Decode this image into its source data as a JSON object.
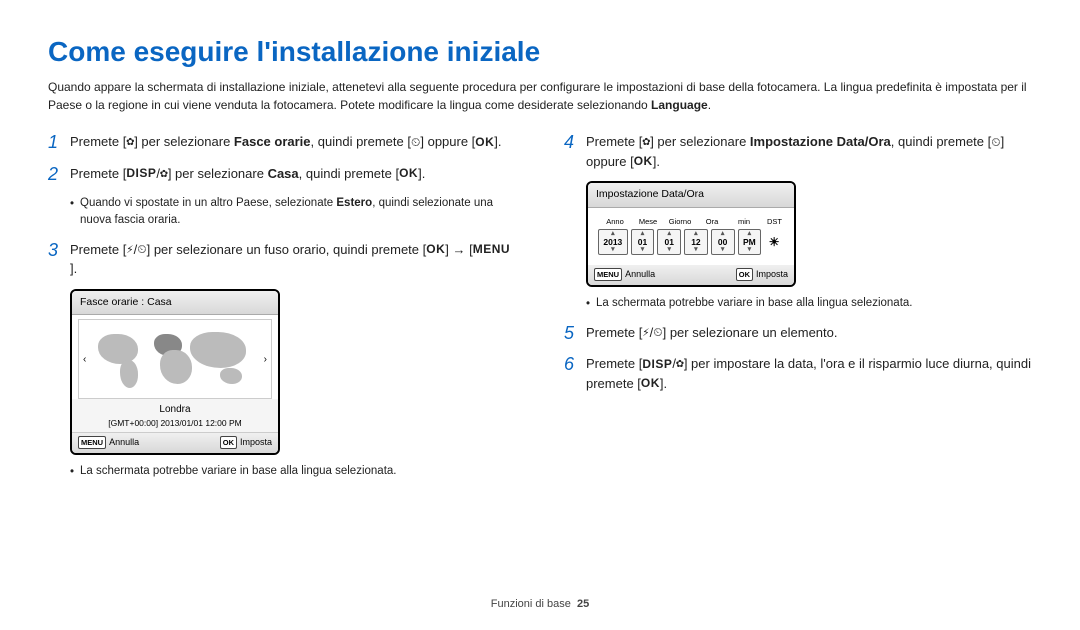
{
  "title": "Come eseguire l'installazione iniziale",
  "intro_part1": "Quando appare la schermata di installazione iniziale, attenetevi alla seguente procedura per configurare le impostazioni di base della fotocamera. La lingua predefinita è impostata per il Paese o la regione in cui viene venduta la fotocamera. Potete modificare la lingua come desiderate selezionando ",
  "intro_lang": "Language",
  "intro_part2": ".",
  "steps_left": {
    "s1": {
      "num": "1",
      "a": "Premete [",
      "b": "] per selezionare ",
      "c": "Fasce orarie",
      "d": ", quindi premete [",
      "e": "] oppure [",
      "f": "]."
    },
    "s2": {
      "num": "2",
      "a": "Premete [",
      "b": "/",
      "c": "] per selezionare ",
      "d": "Casa",
      "e": ", quindi premete [",
      "f": "]."
    },
    "s2b": {
      "a": "Quando vi spostate in un altro Paese, selezionate ",
      "b": "Estero",
      "c": ", quindi selezionate una nuova fascia oraria."
    },
    "s3": {
      "num": "3",
      "a": "Premete [",
      "b": "/",
      "c": "] per selezionare un fuso orario, quindi premete [",
      "d": "] → [",
      "e": "]."
    },
    "s3b": "La schermata potrebbe variare in base alla lingua selezionata."
  },
  "steps_right": {
    "s4": {
      "num": "4",
      "a": "Premete [",
      "b": "] per selezionare ",
      "c": "Impostazione Data/Ora",
      "d": ", quindi premete [",
      "e": "] oppure [",
      "f": "]."
    },
    "s4b": "La schermata potrebbe variare in base alla lingua selezionata.",
    "s5": {
      "num": "5",
      "a": "Premete [",
      "b": "/",
      "c": "] per selezionare un elemento."
    },
    "s6": {
      "num": "6",
      "a": "Premete [",
      "b": "/",
      "c": "] per impostare la data, l'ora e il risparmio luce diurna, quindi premete [",
      "d": "]."
    }
  },
  "lcd_tz": {
    "title": "Fasce orarie : Casa",
    "city": "Londra",
    "datetime": "[GMT+00:00] 2013/01/01 12:00 PM",
    "menu_label": "MENU",
    "cancel": "Annulla",
    "ok_label": "OK",
    "set": "Imposta",
    "left_arrow": "‹",
    "right_arrow": "›"
  },
  "lcd_dt": {
    "title": "Impostazione Data/Ora",
    "labels": {
      "y": "Anno",
      "m": "Mese",
      "d": "Giorno",
      "h": "Ora",
      "min": "min",
      "dst": "DST"
    },
    "values": {
      "y": "2013",
      "m": "01",
      "d": "01",
      "h": "12",
      "min": "00",
      "ampm": "PM"
    },
    "menu_label": "MENU",
    "cancel": "Annulla",
    "ok_label": "OK",
    "set": "Imposta"
  },
  "icons": {
    "flower": "✿",
    "timer": "⏲",
    "flash": "⚡",
    "dst": "☀"
  },
  "labels": {
    "disp": "DISP",
    "ok": "OK",
    "menu": "MENU"
  },
  "footer": {
    "section": "Funzioni di base",
    "page": "25"
  }
}
